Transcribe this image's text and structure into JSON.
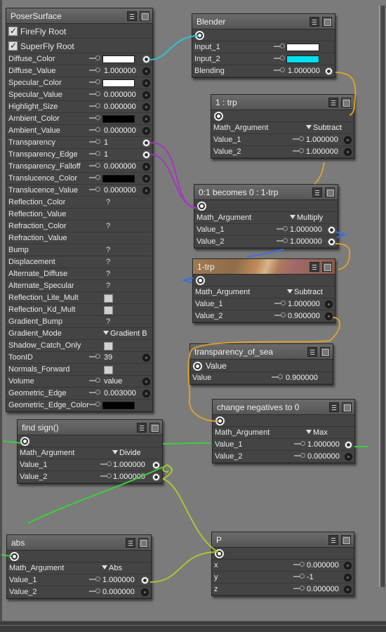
{
  "poser": {
    "title": "PoserSurface",
    "checks": [
      {
        "label": "FireFly Root"
      },
      {
        "label": "SuperFly Root"
      }
    ],
    "rows": [
      {
        "label": "Diffuse_Color",
        "kind": "color",
        "swatch": "#ffffff",
        "port": "linked"
      },
      {
        "label": "Diffuse_Value",
        "kind": "num",
        "value": "1.000000",
        "port": "in"
      },
      {
        "label": "Specular_Color",
        "kind": "color",
        "swatch": "#ffffff",
        "port": "in"
      },
      {
        "label": "Specular_Value",
        "kind": "num",
        "value": "0.000000",
        "port": "in"
      },
      {
        "label": "Highlight_Size",
        "kind": "num",
        "value": "0.000000",
        "port": "in"
      },
      {
        "label": "Ambient_Color",
        "kind": "color",
        "swatch": "#000000",
        "port": "in"
      },
      {
        "label": "Ambient_Value",
        "kind": "num",
        "value": "0.000000",
        "port": "in"
      },
      {
        "label": "Transparency",
        "kind": "num",
        "value": "1",
        "port": "linked"
      },
      {
        "label": "Transparency_Edge",
        "kind": "num",
        "value": "1",
        "port": "linked"
      },
      {
        "label": "Transparency_Falloff",
        "kind": "num",
        "value": "0.000000",
        "port": "in"
      },
      {
        "label": "Translucence_Color",
        "kind": "color",
        "swatch": "#000000",
        "port": "in"
      },
      {
        "label": "Translucence_Value",
        "kind": "num",
        "value": "0.000000",
        "port": "in"
      },
      {
        "label": "Reflection_Color",
        "kind": "q",
        "value": "?"
      },
      {
        "label": "Reflection_Value",
        "kind": "blank"
      },
      {
        "label": "Refraction_Color",
        "kind": "q",
        "value": "?"
      },
      {
        "label": "Refraction_Value",
        "kind": "blank"
      },
      {
        "label": "Bump",
        "kind": "q",
        "value": "?"
      },
      {
        "label": "Displacement",
        "kind": "q",
        "value": "?"
      },
      {
        "label": "Alternate_Diffuse",
        "kind": "q",
        "value": "?"
      },
      {
        "label": "Alternate_Specular",
        "kind": "q",
        "value": "?"
      },
      {
        "label": "Reflection_Lite_Mult",
        "kind": "box"
      },
      {
        "label": "Reflection_Kd_Mult",
        "kind": "box"
      },
      {
        "label": "Gradient_Bump",
        "kind": "q",
        "value": "?"
      },
      {
        "label": "Gradient_Mode",
        "kind": "dd",
        "value": "Gradient B"
      },
      {
        "label": "Shadow_Catch_Only",
        "kind": "box"
      },
      {
        "label": "ToonID",
        "kind": "num",
        "value": "39",
        "port": "in"
      },
      {
        "label": "Normals_Forward",
        "kind": "box"
      },
      {
        "label": "Volume",
        "kind": "num",
        "value": "value",
        "port": "in"
      },
      {
        "label": "Geometric_Edge",
        "kind": "num",
        "value": "0.003000",
        "port": "in"
      },
      {
        "label": "Geometric_Edge_Color",
        "kind": "color",
        "swatch": "#000000",
        "port": "none"
      }
    ]
  },
  "blender": {
    "title": "Blender",
    "rows": [
      {
        "label": "Input_1",
        "kind": "color",
        "swatch": "#ffffff",
        "port": "none"
      },
      {
        "label": "Input_2",
        "kind": "color",
        "swatch": "#00e0ee",
        "port": "none"
      },
      {
        "label": "Blending",
        "kind": "num",
        "value": "1.000000",
        "port": "linked"
      }
    ]
  },
  "trp": {
    "title": "1 : trp",
    "rows": [
      {
        "label": "Math_Argument",
        "kind": "dd",
        "value": "Subtract"
      },
      {
        "label": "Value_1",
        "kind": "num",
        "value": "1.000000",
        "port": "in"
      },
      {
        "label": "Value_2",
        "kind": "num",
        "value": "1.000000",
        "port": "in"
      }
    ]
  },
  "becomes": {
    "title": "0:1 becomes 0 : 1-trp",
    "rows": [
      {
        "label": "Math_Argument",
        "kind": "dd",
        "value": "Multiply"
      },
      {
        "label": "Value_1",
        "kind": "num",
        "value": "1.000000",
        "port": "linked"
      },
      {
        "label": "Value_2",
        "kind": "num",
        "value": "1.000000",
        "port": "linked"
      }
    ]
  },
  "onetrp": {
    "title": "1-trp",
    "rows": [
      {
        "label": "Math_Argument",
        "kind": "dd",
        "value": "Subtract"
      },
      {
        "label": "Value_1",
        "kind": "num",
        "value": "1.000000",
        "port": "in"
      },
      {
        "label": "Value_2",
        "kind": "num",
        "value": "0.900000",
        "port": "in"
      }
    ]
  },
  "sea": {
    "title": "transparency_of_sea",
    "output_label": "Value",
    "rows": [
      {
        "label": "Value",
        "kind": "num",
        "value": "0.900000",
        "port": "none"
      }
    ]
  },
  "negatives": {
    "title": "change negatives to 0",
    "rows": [
      {
        "label": "Math_Argument",
        "kind": "dd",
        "value": "Max"
      },
      {
        "label": "Value_1",
        "kind": "num",
        "value": "1.000000",
        "port": "linked"
      },
      {
        "label": "Value_2",
        "kind": "num",
        "value": "0.000000",
        "port": "in"
      }
    ]
  },
  "findsign": {
    "title": "find sign()",
    "rows": [
      {
        "label": "Math_Argument",
        "kind": "dd",
        "value": "Divide"
      },
      {
        "label": "Value_1",
        "kind": "num",
        "value": "1.000000",
        "port": "linked"
      },
      {
        "label": "Value_2",
        "kind": "num",
        "value": "1.000000",
        "port": "linked"
      }
    ]
  },
  "abs": {
    "title": "abs",
    "rows": [
      {
        "label": "Math_Argument",
        "kind": "dd",
        "value": "Abs"
      },
      {
        "label": "Value_1",
        "kind": "num",
        "value": "1.000000",
        "port": "linked"
      },
      {
        "label": "Value_2",
        "kind": "num",
        "value": "0.000000",
        "port": "in"
      }
    ]
  },
  "p": {
    "title": "P",
    "rows": [
      {
        "label": "x",
        "kind": "num",
        "value": "0.000000",
        "port": "in"
      },
      {
        "label": "y",
        "kind": "num",
        "value": "-1",
        "port": "in"
      },
      {
        "label": "z",
        "kind": "num",
        "value": "0.000000",
        "port": "in"
      }
    ]
  },
  "colors": {
    "canvas": "#7b7b7b",
    "wire_cyan": "#2bc4d4",
    "wire_purple": "#a13ab9",
    "wire_orange": "#d8a030",
    "wire_blue": "#3a6ee0",
    "wire_green": "#3ccf3c",
    "wire_yellowgreen": "#a8c830"
  }
}
